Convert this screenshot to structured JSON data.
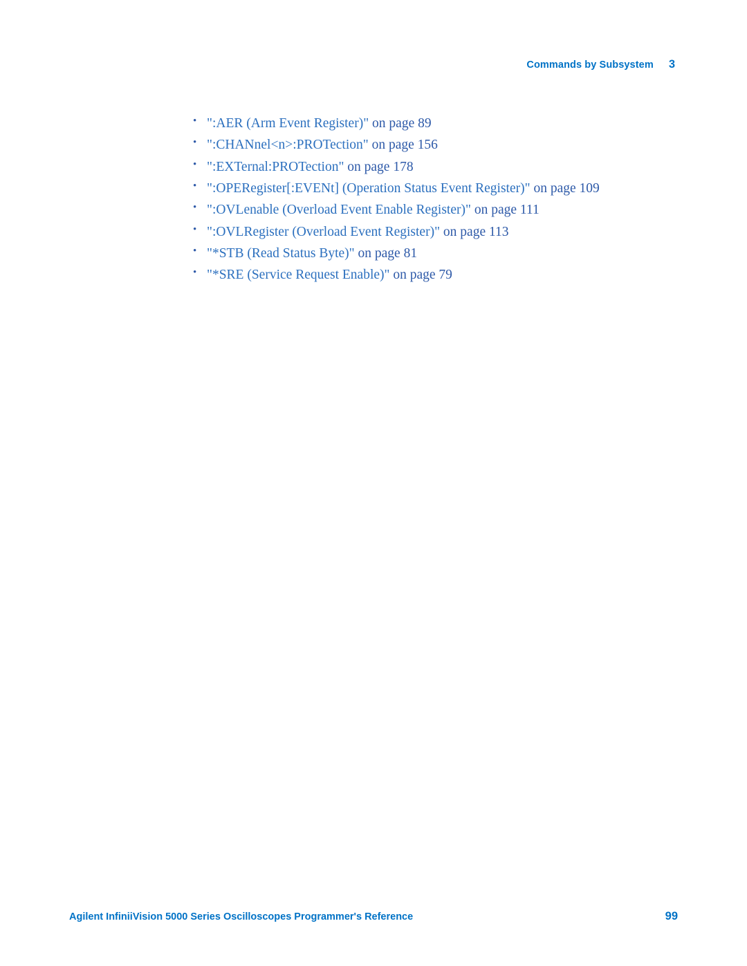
{
  "header": {
    "title": "Commands by Subsystem",
    "chapter": "3"
  },
  "list": {
    "items": [
      {
        "link": "\":AER (Arm Event Register)\"",
        "on_page": "on page",
        "page": "89"
      },
      {
        "link": "\":CHANnel<n>:PROTection\"",
        "on_page": "on page",
        "page": "156"
      },
      {
        "link": "\":EXTernal:PROTection\"",
        "on_page": "on page",
        "page": "178"
      },
      {
        "link": "\":OPERegister[:EVENt] (Operation Status Event Register)\"",
        "on_page": "on page",
        "page": "109"
      },
      {
        "link": "\":OVLenable (Overload Event Enable Register)\"",
        "on_page": "on page",
        "page": "111"
      },
      {
        "link": "\":OVLRegister (Overload Event Register)\"",
        "on_page": "on page",
        "page": "113"
      },
      {
        "link": "\"*STB (Read Status Byte)\"",
        "on_page": "on page",
        "page": "81"
      },
      {
        "link": "\"*SRE (Service Request Enable)\"",
        "on_page": "on page",
        "page": "79"
      }
    ]
  },
  "footer": {
    "left": "Agilent InfiniiVision 5000 Series Oscilloscopes Programmer's Reference",
    "right": "99"
  }
}
